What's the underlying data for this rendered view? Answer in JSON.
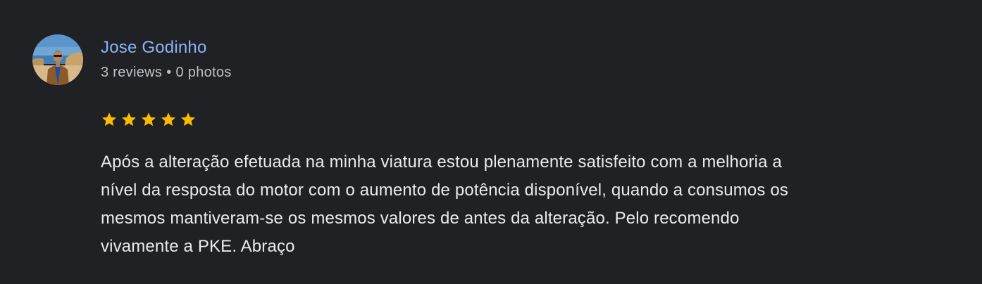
{
  "review": {
    "author": {
      "name": "Jose Godinho",
      "reviews_count": "3 reviews",
      "separator": "•",
      "photos_count": "0 photos"
    },
    "rating": {
      "stars": 5,
      "max_stars": 5,
      "star_color": "#fbbc04",
      "icon": "star-icon"
    },
    "text_lines": [
      "Após a alteração efetuada na minha viatura estou plenamente satisfeito com a melhoria a",
      "nível da resposta do motor com o aumento de potência disponível, quando a consumos os",
      "mesmos mantiveram-se os mesmos valores de antes da alteração. Pelo recomendo",
      "vivamente a PKE. Abraço"
    ]
  },
  "theme": {
    "background": "#202124",
    "name_color": "#8ab4f8",
    "meta_color": "#bdc1c6",
    "text_color": "#e8eaed"
  }
}
